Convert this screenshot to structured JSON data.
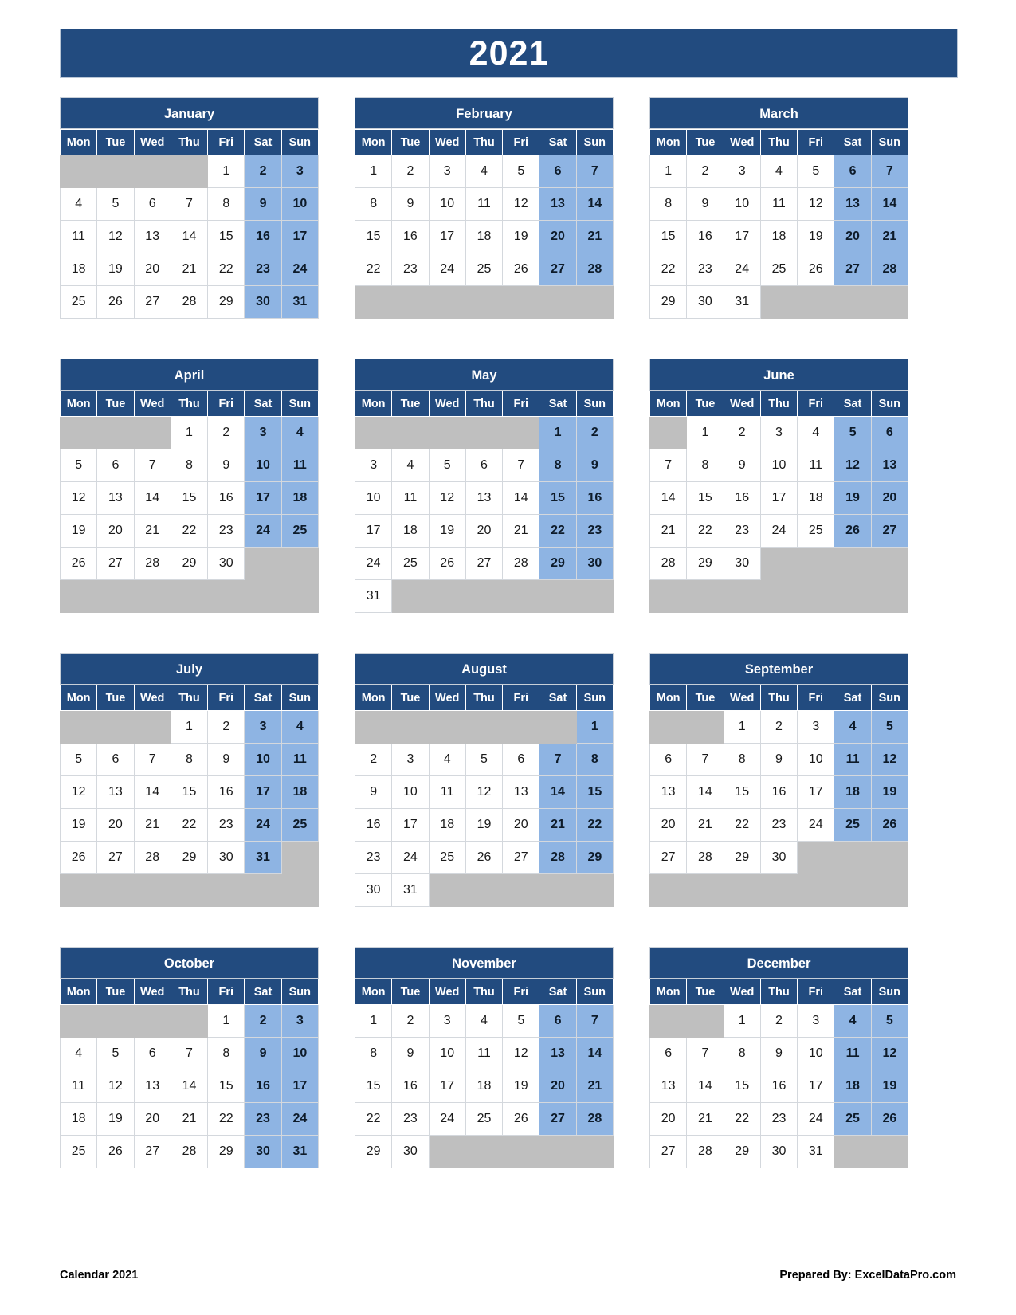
{
  "document": {
    "title": "2021",
    "footer_left": "Calendar 2021",
    "footer_right": "Prepared By: ExcelDataPro.com"
  },
  "colors": {
    "header_blue": "#224b7f",
    "weekend_blue": "#8eb4e3",
    "blank_gray": "#bfbfbf",
    "cell_white": "#ffffff",
    "grid_line": "#d4d8dd"
  },
  "weekday_headers": [
    "Mon",
    "Tue",
    "Wed",
    "Thu",
    "Fri",
    "Sat",
    "Sun"
  ],
  "months": [
    {
      "name": "January",
      "weeks": [
        [
          "",
          "",
          "",
          "",
          "1",
          "2",
          "3"
        ],
        [
          "4",
          "5",
          "6",
          "7",
          "8",
          "9",
          "10"
        ],
        [
          "11",
          "12",
          "13",
          "14",
          "15",
          "16",
          "17"
        ],
        [
          "18",
          "19",
          "20",
          "21",
          "22",
          "23",
          "24"
        ],
        [
          "25",
          "26",
          "27",
          "28",
          "29",
          "30",
          "31"
        ]
      ],
      "filler_rows": 0
    },
    {
      "name": "February",
      "weeks": [
        [
          "1",
          "2",
          "3",
          "4",
          "5",
          "6",
          "7"
        ],
        [
          "8",
          "9",
          "10",
          "11",
          "12",
          "13",
          "14"
        ],
        [
          "15",
          "16",
          "17",
          "18",
          "19",
          "20",
          "21"
        ],
        [
          "22",
          "23",
          "24",
          "25",
          "26",
          "27",
          "28"
        ]
      ],
      "filler_rows": 1
    },
    {
      "name": "March",
      "weeks": [
        [
          "1",
          "2",
          "3",
          "4",
          "5",
          "6",
          "7"
        ],
        [
          "8",
          "9",
          "10",
          "11",
          "12",
          "13",
          "14"
        ],
        [
          "15",
          "16",
          "17",
          "18",
          "19",
          "20",
          "21"
        ],
        [
          "22",
          "23",
          "24",
          "25",
          "26",
          "27",
          "28"
        ],
        [
          "29",
          "30",
          "31",
          "",
          "",
          "",
          ""
        ]
      ],
      "filler_rows": 0
    },
    {
      "name": "April",
      "weeks": [
        [
          "",
          "",
          "",
          "1",
          "2",
          "3",
          "4"
        ],
        [
          "5",
          "6",
          "7",
          "8",
          "9",
          "10",
          "11"
        ],
        [
          "12",
          "13",
          "14",
          "15",
          "16",
          "17",
          "18"
        ],
        [
          "19",
          "20",
          "21",
          "22",
          "23",
          "24",
          "25"
        ],
        [
          "26",
          "27",
          "28",
          "29",
          "30",
          "",
          ""
        ]
      ],
      "filler_rows": 1
    },
    {
      "name": "May",
      "weeks": [
        [
          "",
          "",
          "",
          "",
          "",
          "1",
          "2"
        ],
        [
          "3",
          "4",
          "5",
          "6",
          "7",
          "8",
          "9"
        ],
        [
          "10",
          "11",
          "12",
          "13",
          "14",
          "15",
          "16"
        ],
        [
          "17",
          "18",
          "19",
          "20",
          "21",
          "22",
          "23"
        ],
        [
          "24",
          "25",
          "26",
          "27",
          "28",
          "29",
          "30"
        ],
        [
          "31",
          "",
          "",
          "",
          "",
          "",
          ""
        ]
      ],
      "filler_rows": 0
    },
    {
      "name": "June",
      "weeks": [
        [
          "",
          "1",
          "2",
          "3",
          "4",
          "5",
          "6"
        ],
        [
          "7",
          "8",
          "9",
          "10",
          "11",
          "12",
          "13"
        ],
        [
          "14",
          "15",
          "16",
          "17",
          "18",
          "19",
          "20"
        ],
        [
          "21",
          "22",
          "23",
          "24",
          "25",
          "26",
          "27"
        ],
        [
          "28",
          "29",
          "30",
          "",
          "",
          "",
          ""
        ]
      ],
      "filler_rows": 1
    },
    {
      "name": "July",
      "weeks": [
        [
          "",
          "",
          "",
          "1",
          "2",
          "3",
          "4"
        ],
        [
          "5",
          "6",
          "7",
          "8",
          "9",
          "10",
          "11"
        ],
        [
          "12",
          "13",
          "14",
          "15",
          "16",
          "17",
          "18"
        ],
        [
          "19",
          "20",
          "21",
          "22",
          "23",
          "24",
          "25"
        ],
        [
          "26",
          "27",
          "28",
          "29",
          "30",
          "31",
          ""
        ]
      ],
      "filler_rows": 1
    },
    {
      "name": "August",
      "weeks": [
        [
          "",
          "",
          "",
          "",
          "",
          "",
          "1"
        ],
        [
          "2",
          "3",
          "4",
          "5",
          "6",
          "7",
          "8"
        ],
        [
          "9",
          "10",
          "11",
          "12",
          "13",
          "14",
          "15"
        ],
        [
          "16",
          "17",
          "18",
          "19",
          "20",
          "21",
          "22"
        ],
        [
          "23",
          "24",
          "25",
          "26",
          "27",
          "28",
          "29"
        ],
        [
          "30",
          "31",
          "",
          "",
          "",
          "",
          ""
        ]
      ],
      "filler_rows": 0
    },
    {
      "name": "September",
      "weeks": [
        [
          "",
          "",
          "1",
          "2",
          "3",
          "4",
          "5"
        ],
        [
          "6",
          "7",
          "8",
          "9",
          "10",
          "11",
          "12"
        ],
        [
          "13",
          "14",
          "15",
          "16",
          "17",
          "18",
          "19"
        ],
        [
          "20",
          "21",
          "22",
          "23",
          "24",
          "25",
          "26"
        ],
        [
          "27",
          "28",
          "29",
          "30",
          "",
          "",
          ""
        ]
      ],
      "filler_rows": 1
    },
    {
      "name": "October",
      "weeks": [
        [
          "",
          "",
          "",
          "",
          "1",
          "2",
          "3"
        ],
        [
          "4",
          "5",
          "6",
          "7",
          "8",
          "9",
          "10"
        ],
        [
          "11",
          "12",
          "13",
          "14",
          "15",
          "16",
          "17"
        ],
        [
          "18",
          "19",
          "20",
          "21",
          "22",
          "23",
          "24"
        ],
        [
          "25",
          "26",
          "27",
          "28",
          "29",
          "30",
          "31"
        ]
      ],
      "filler_rows": 0
    },
    {
      "name": "November",
      "weeks": [
        [
          "1",
          "2",
          "3",
          "4",
          "5",
          "6",
          "7"
        ],
        [
          "8",
          "9",
          "10",
          "11",
          "12",
          "13",
          "14"
        ],
        [
          "15",
          "16",
          "17",
          "18",
          "19",
          "20",
          "21"
        ],
        [
          "22",
          "23",
          "24",
          "25",
          "26",
          "27",
          "28"
        ],
        [
          "29",
          "30",
          "",
          "",
          "",
          "",
          ""
        ]
      ],
      "filler_rows": 0
    },
    {
      "name": "December",
      "weeks": [
        [
          "",
          "",
          "1",
          "2",
          "3",
          "4",
          "5"
        ],
        [
          "6",
          "7",
          "8",
          "9",
          "10",
          "11",
          "12"
        ],
        [
          "13",
          "14",
          "15",
          "16",
          "17",
          "18",
          "19"
        ],
        [
          "20",
          "21",
          "22",
          "23",
          "24",
          "25",
          "26"
        ],
        [
          "27",
          "28",
          "29",
          "30",
          "31",
          "",
          ""
        ]
      ],
      "filler_rows": 0
    }
  ]
}
